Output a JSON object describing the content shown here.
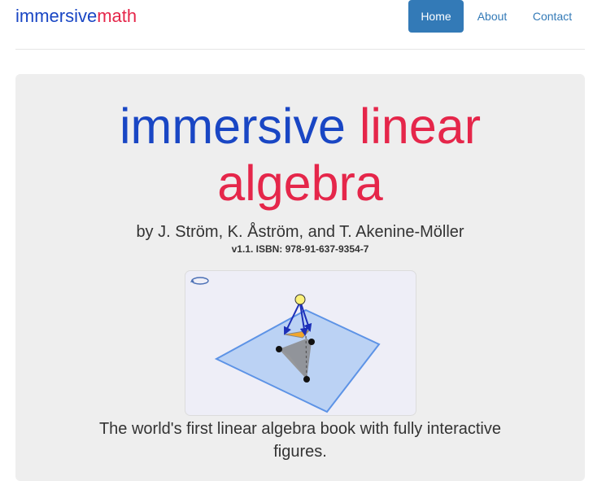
{
  "brand": {
    "part1": "immersive",
    "part2": "math",
    "color_blue": "#1946c4",
    "color_red": "#e5264a"
  },
  "nav": {
    "items": [
      {
        "label": "Home",
        "active": true
      },
      {
        "label": "About",
        "active": false
      },
      {
        "label": "Contact",
        "active": false
      }
    ],
    "active_color": "#337ab7"
  },
  "hero": {
    "title_blue": "immersive",
    "title_red_1": "linear",
    "title_red_2": "algebra",
    "authors": "by J. Ström, K. Åström, and T. Akenine-Möller",
    "version": "v1.1. ISBN: 978-91-637-9354-7",
    "figure_icons": [
      "rotate-icon"
    ],
    "tagline_line1": "The world's first linear algebra book with fully interactive",
    "tagline_line2": "figures."
  }
}
